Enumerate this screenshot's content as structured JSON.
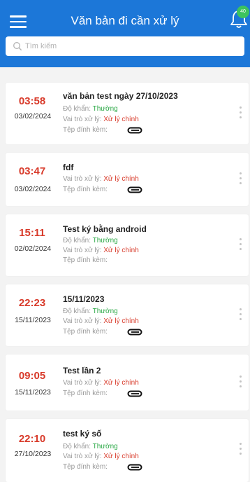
{
  "header": {
    "title": "Văn bản đi cần xử lý",
    "badge": "40",
    "accent": "#1c77d8"
  },
  "search": {
    "placeholder": "Tìm kiếm",
    "value": ""
  },
  "labels": {
    "urgency": "Độ khẩn:",
    "role": "Vai trò xử lý:",
    "attachment": "Tệp đính kèm:"
  },
  "icons": [
    "menu-icon",
    "bell-icon",
    "search-icon",
    "paperclip-icon",
    "more-vertical-icon"
  ],
  "colors": {
    "time": "#d83a2a",
    "urgency_normal": "#2aa845",
    "role_main": "#d83a2a"
  },
  "items": [
    {
      "time": "03:58",
      "date": "03/02/2024",
      "title": "văn bản test ngày 27/10/2023",
      "urgency": "Thường",
      "role": "Xử lý chính",
      "attachment": true
    },
    {
      "time": "03:47",
      "date": "03/02/2024",
      "title": "fdf",
      "urgency": "",
      "role": "Xử lý chính",
      "attachment": true
    },
    {
      "time": "15:11",
      "date": "02/02/2024",
      "title": "Test ký bằng android",
      "urgency": "Thường",
      "role": "Xử lý chính",
      "attachment": false
    },
    {
      "time": "22:23",
      "date": "15/11/2023",
      "title": "15/11/2023",
      "urgency": "Thường",
      "role": "Xử lý chính",
      "attachment": true
    },
    {
      "time": "09:05",
      "date": "15/11/2023",
      "title": "Test lần 2",
      "urgency": "",
      "role": "Xử lý chính",
      "attachment": true
    },
    {
      "time": "22:10",
      "date": "27/10/2023",
      "title": "test ký số",
      "urgency": "Thường",
      "role": "Xử lý chính",
      "attachment": true
    }
  ]
}
